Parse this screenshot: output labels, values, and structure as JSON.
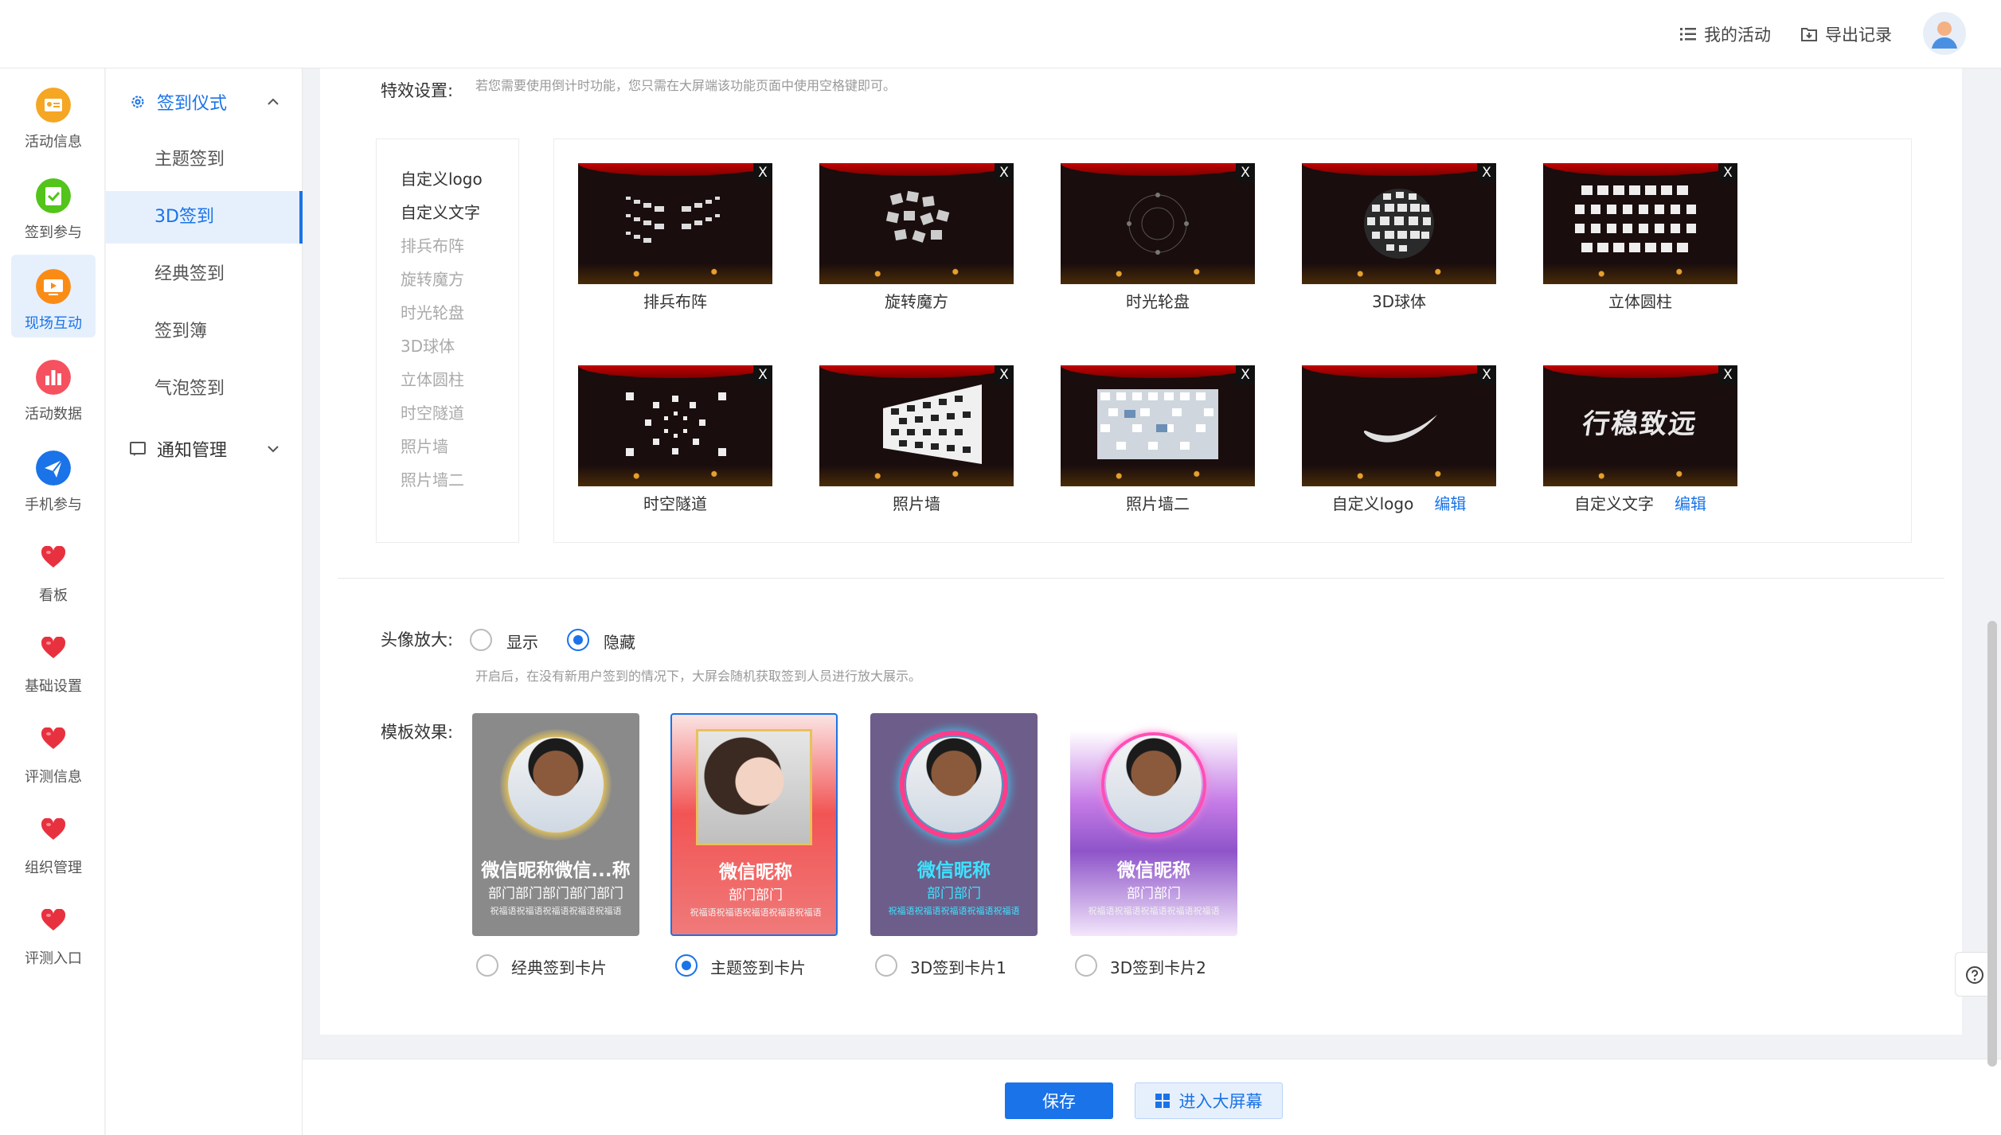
{
  "topbar": {
    "my_activity": "我的活动",
    "export_records": "导出记录"
  },
  "rail": [
    {
      "label": "活动信息",
      "icon": "card-icon",
      "color": "#f5a623"
    },
    {
      "label": "签到参与",
      "icon": "check-icon",
      "color": "#52c41a"
    },
    {
      "label": "现场互动",
      "icon": "screen-icon",
      "color": "#fa8c16"
    },
    {
      "label": "活动数据",
      "icon": "bar-chart-icon",
      "color": "#f5515f"
    },
    {
      "label": "手机参与",
      "icon": "send-icon",
      "color": "#1a73e8"
    },
    {
      "label": "看板",
      "icon": "heart-icon",
      "color": "#e8313f"
    },
    {
      "label": "基础设置",
      "icon": "heart-icon",
      "color": "#e8313f"
    },
    {
      "label": "评测信息",
      "icon": "heart-icon",
      "color": "#e8313f"
    },
    {
      "label": "组织管理",
      "icon": "heart-icon",
      "color": "#e8313f"
    },
    {
      "label": "评测入口",
      "icon": "heart-icon",
      "color": "#e8313f"
    }
  ],
  "subnav": {
    "group1": "签到仪式",
    "items": [
      "主题签到",
      "3D签到",
      "经典签到",
      "签到簿",
      "气泡签到"
    ],
    "group2": "通知管理"
  },
  "effects": {
    "label": "特效设置:",
    "hint": "若您需要使用倒计时功能，您只需在大屏端该功能页面中使用空格键即可。",
    "list": [
      "自定义logo",
      "自定义文字",
      "排兵布阵",
      "旋转魔方",
      "时光轮盘",
      "3D球体",
      "立体圆柱",
      "时空隧道",
      "照片墙",
      "照片墙二"
    ],
    "thumbs": [
      "排兵布阵",
      "旋转魔方",
      "时光轮盘",
      "3D球体",
      "立体圆柱",
      "时空隧道",
      "照片墙",
      "照片墙二",
      "自定义logo",
      "自定义文字"
    ],
    "close": "X",
    "edit": "编辑",
    "logo_text": "行稳致远"
  },
  "avatar_zoom": {
    "label": "头像放大:",
    "show": "显示",
    "hide": "隐藏",
    "hint": "开启后，在没有新用户签到的情况下，大屏会随机获取签到人员进行放大展示。"
  },
  "template": {
    "label": "模板效果:",
    "cards": [
      {
        "name": "微信昵称微信...称",
        "dept": "部门部门部门部门部门",
        "bless": "祝福语祝福语祝福语祝福语祝福语",
        "option": "经典签到卡片"
      },
      {
        "name": "微信昵称",
        "dept": "部门部门",
        "bless": "祝福语祝福语祝福语祝福语祝福语",
        "option": "主题签到卡片"
      },
      {
        "name": "微信昵称",
        "dept": "部门部门",
        "bless": "祝福语祝福语祝福语祝福语祝福语",
        "option": "3D签到卡片1"
      },
      {
        "name": "微信昵称",
        "dept": "部门部门",
        "bless": "祝福语祝福语祝福语祝福语祝福语",
        "option": "3D签到卡片2"
      }
    ]
  },
  "footer": {
    "save": "保存",
    "enter_screen": "进入大屏幕"
  },
  "colors": {
    "primary": "#1a73e8",
    "heart": "#e8313f"
  }
}
